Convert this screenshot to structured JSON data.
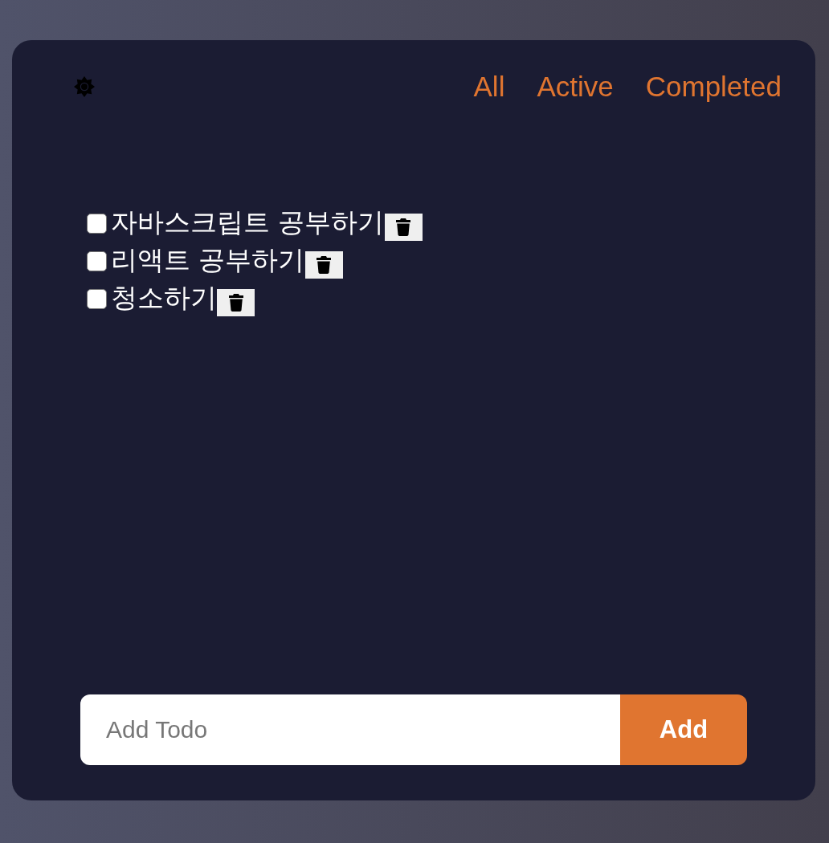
{
  "filters": [
    {
      "label": "All"
    },
    {
      "label": "Active"
    },
    {
      "label": "Completed"
    }
  ],
  "todos": [
    {
      "text": "자바스크립트 공부하기",
      "checked": false
    },
    {
      "text": "리액트 공부하기",
      "checked": false
    },
    {
      "text": "청소하기",
      "checked": false
    }
  ],
  "add_form": {
    "placeholder": "Add Todo",
    "button": "Add"
  }
}
